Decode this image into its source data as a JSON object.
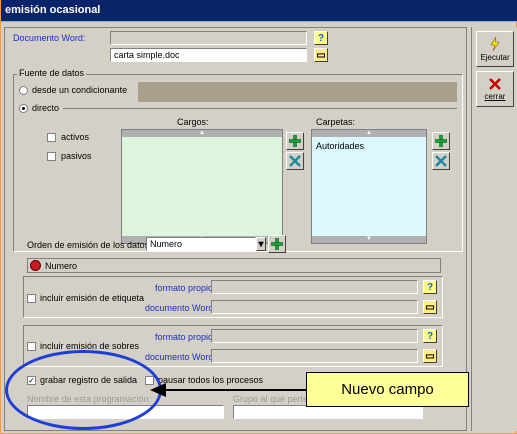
{
  "window": {
    "title": "emisión ocasional"
  },
  "documento_word": {
    "label": "Documento Word:",
    "value": "",
    "file": "carta simple.doc"
  },
  "fuente": {
    "title": "Fuente de datos",
    "opt_condicionante": "desde un condicionante",
    "opt_directo": "directo",
    "cargos_label": "Cargos:",
    "carpetas_label": "Carpetas:",
    "cb_activos": "activos",
    "cb_pasivos": "pasivos",
    "carpetas_items": [
      "Autoridades"
    ]
  },
  "orden": {
    "label": "Orden de emisión de los datos:",
    "value": "Numero",
    "list_item": "Numero"
  },
  "etiqueta": {
    "cb_label": "incluir emisión de etiqueta",
    "formato_label": "formato propio",
    "documento_label": "documento Word"
  },
  "sobres": {
    "cb_label": "incluir emisión de sobres",
    "formato_label": "formato propio",
    "documento_label": "documento Word"
  },
  "bottom": {
    "grabar_label": "grabar registro de salida",
    "pausar_label": "pausar todos los procesos",
    "nombre_label": "Nombre de esta programación:",
    "grupo_label": "Grupo al que pertenece"
  },
  "sidebar": {
    "ejecutar": "Ejecutar",
    "cerrar": "cerrar"
  },
  "callout": {
    "text": "Nuevo campo"
  },
  "colors": {
    "title_bg": "#0a246a",
    "accent_orange": "#ff9a3c",
    "list_green": "#dcf5dc",
    "list_cyan": "#dcf8fc",
    "highlight_blue": "#1e3fd6",
    "callout_yellow": "#ffff99"
  }
}
